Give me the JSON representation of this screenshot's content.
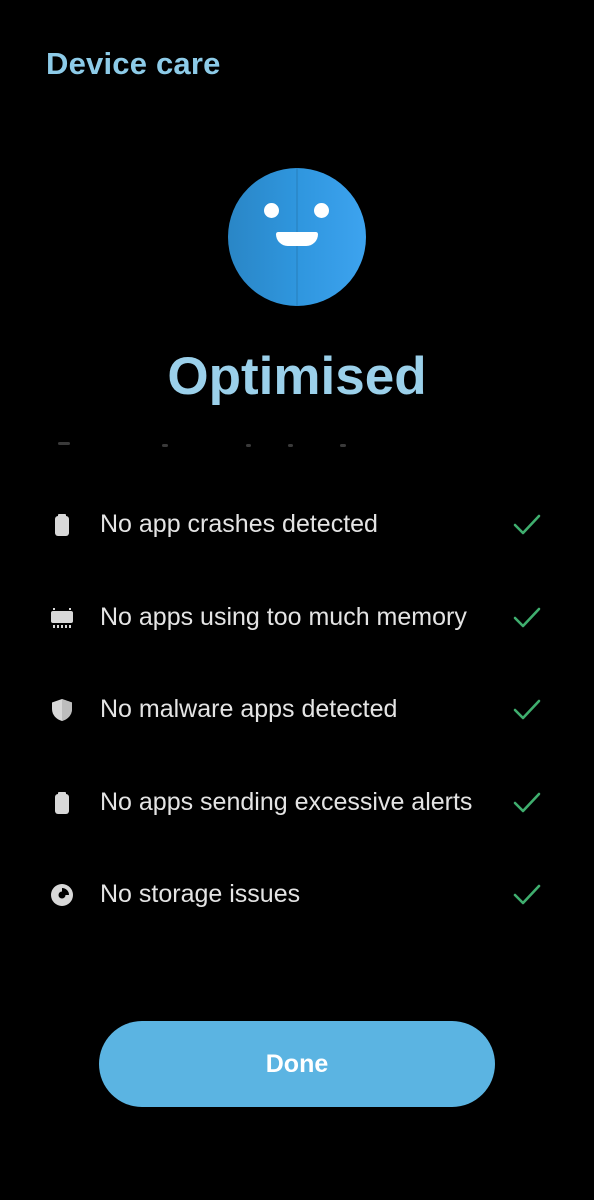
{
  "header": {
    "title": "Device care"
  },
  "status": {
    "icon": "smiley-face-icon",
    "label": "Optimised",
    "color": "#9bd0ea",
    "face_color": "#2f96de"
  },
  "results": [
    {
      "icon": "battery-icon",
      "label": "No app crashes detected",
      "status_icon": "check-icon"
    },
    {
      "icon": "memory-chip-icon",
      "label": "No apps using too much memory",
      "status_icon": "check-icon"
    },
    {
      "icon": "shield-icon",
      "label": "No malware apps detected",
      "status_icon": "check-icon"
    },
    {
      "icon": "battery-icon",
      "label": "No apps sending excessive alerts",
      "status_icon": "check-icon"
    },
    {
      "icon": "storage-pie-icon",
      "label": "No storage issues",
      "status_icon": "check-icon"
    }
  ],
  "actions": {
    "done_label": "Done"
  },
  "colors": {
    "accent": "#5bb4e2",
    "check": "#3fae6e",
    "background": "#000000"
  }
}
